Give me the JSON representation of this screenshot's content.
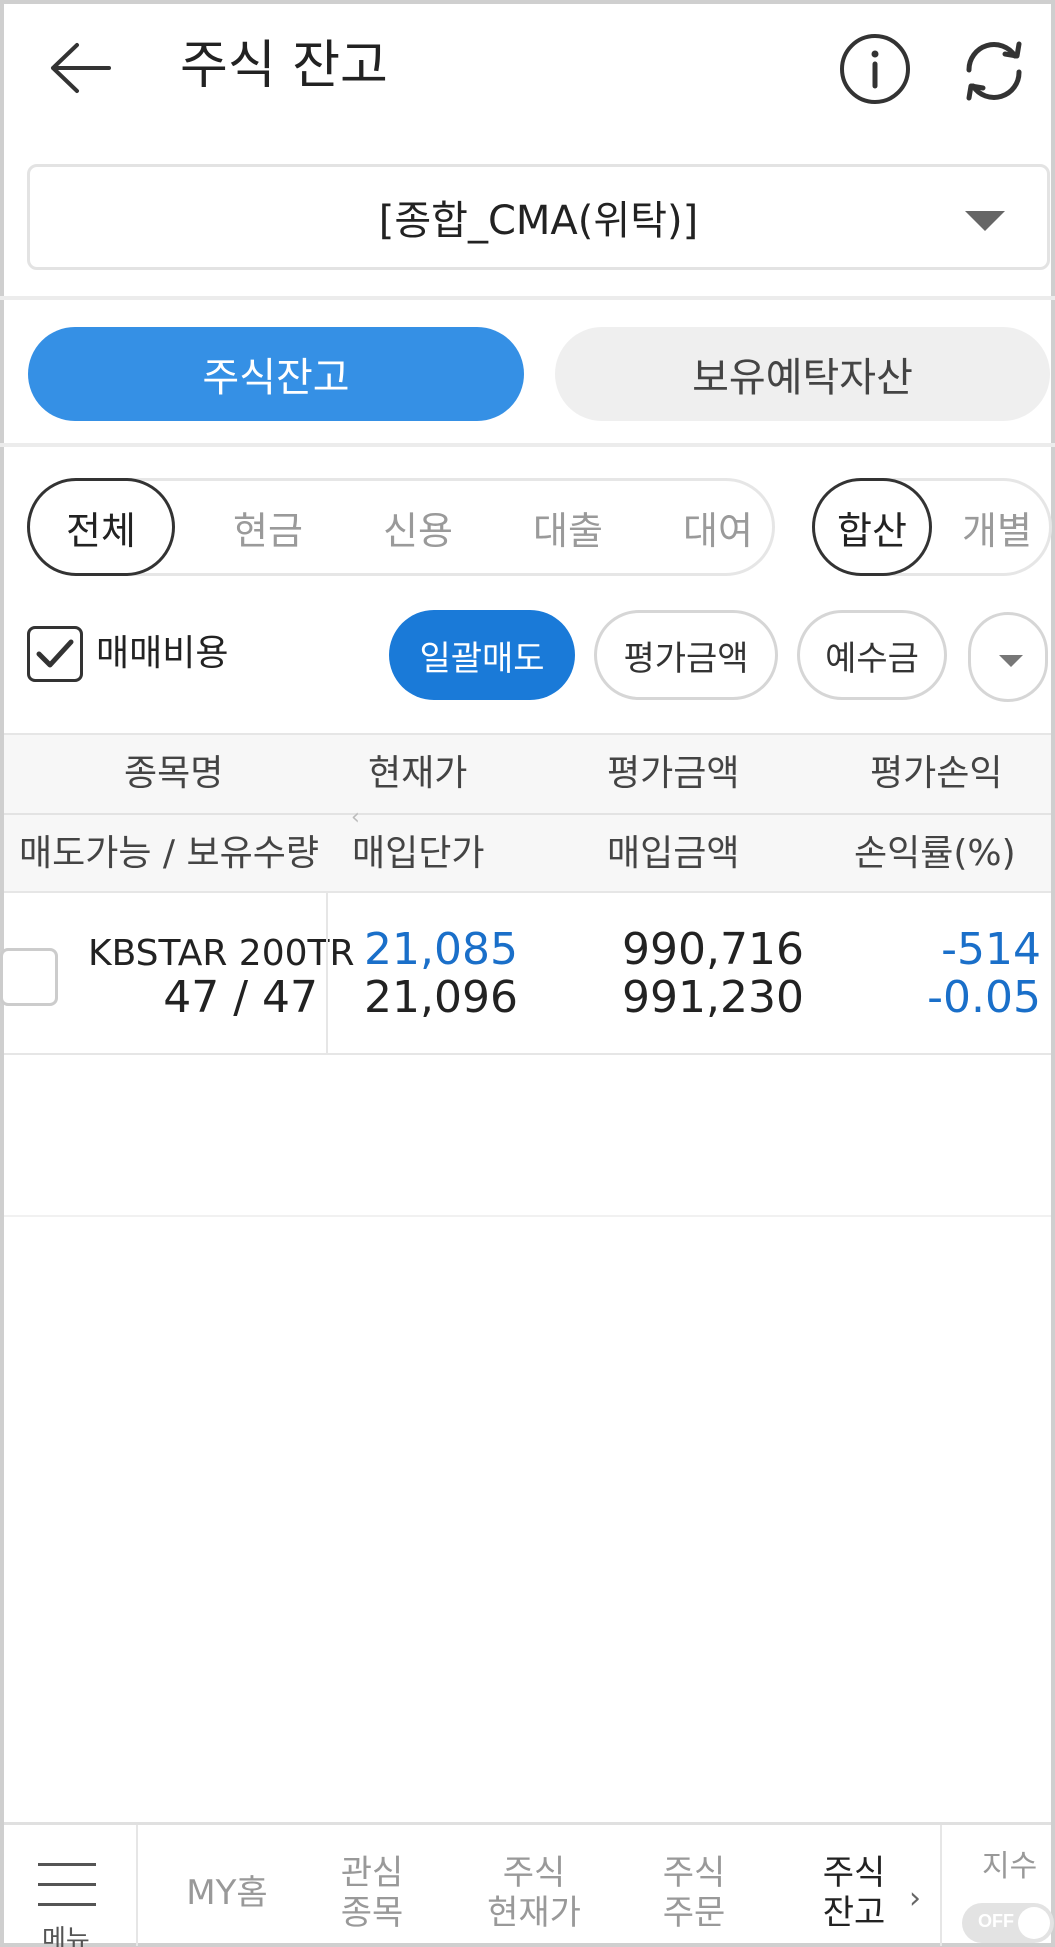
{
  "header": {
    "title": "주식 잔고"
  },
  "account": {
    "selected": "[종합_CMA(위탁)]"
  },
  "main_tabs": [
    {
      "label": "주식잔고",
      "active": true
    },
    {
      "label": "보유예탁자산",
      "active": false
    }
  ],
  "type_filter": [
    {
      "label": "전체",
      "active": true
    },
    {
      "label": "현금",
      "active": false
    },
    {
      "label": "신용",
      "active": false
    },
    {
      "label": "대출",
      "active": false
    },
    {
      "label": "대여",
      "active": false
    }
  ],
  "view_filter": [
    {
      "label": "합산",
      "active": true
    },
    {
      "label": "개별",
      "active": false
    }
  ],
  "options": {
    "fee_checkbox_label": "매매비용",
    "fee_checked": true,
    "sell_all": "일괄매도",
    "eval_amount": "평가금액",
    "deposit": "예수금"
  },
  "table": {
    "header_row1": [
      "종목명",
      "현재가",
      "평가금액",
      "평가손익"
    ],
    "header_row2": [
      "매도가능 / 보유수량",
      "매입단가",
      "매입금액",
      "손익률(%)"
    ],
    "rows": [
      {
        "name": "KBSTAR 200TR",
        "qty": "47 / 47",
        "current_price": "21,085",
        "avg_price": "21,096",
        "eval_amount": "990,716",
        "buy_amount": "991,230",
        "pnl": "-514",
        "pnl_rate": "-0.05"
      }
    ]
  },
  "colors": {
    "accent": "#3590e5",
    "sell_button": "#1a7ad8",
    "negative": "#1a6fc9"
  },
  "bottom_nav": {
    "menu_label": "메뉴",
    "items": [
      {
        "line1": "MY홈",
        "line2": "",
        "active": false
      },
      {
        "line1": "관심",
        "line2": "종목",
        "active": false
      },
      {
        "line1": "주식",
        "line2": "현재가",
        "active": false
      },
      {
        "line1": "주식",
        "line2": "주문",
        "active": false
      },
      {
        "line1": "주식",
        "line2": "잔고",
        "active": true
      }
    ],
    "index_label": "지수",
    "index_toggle": "OFF"
  }
}
